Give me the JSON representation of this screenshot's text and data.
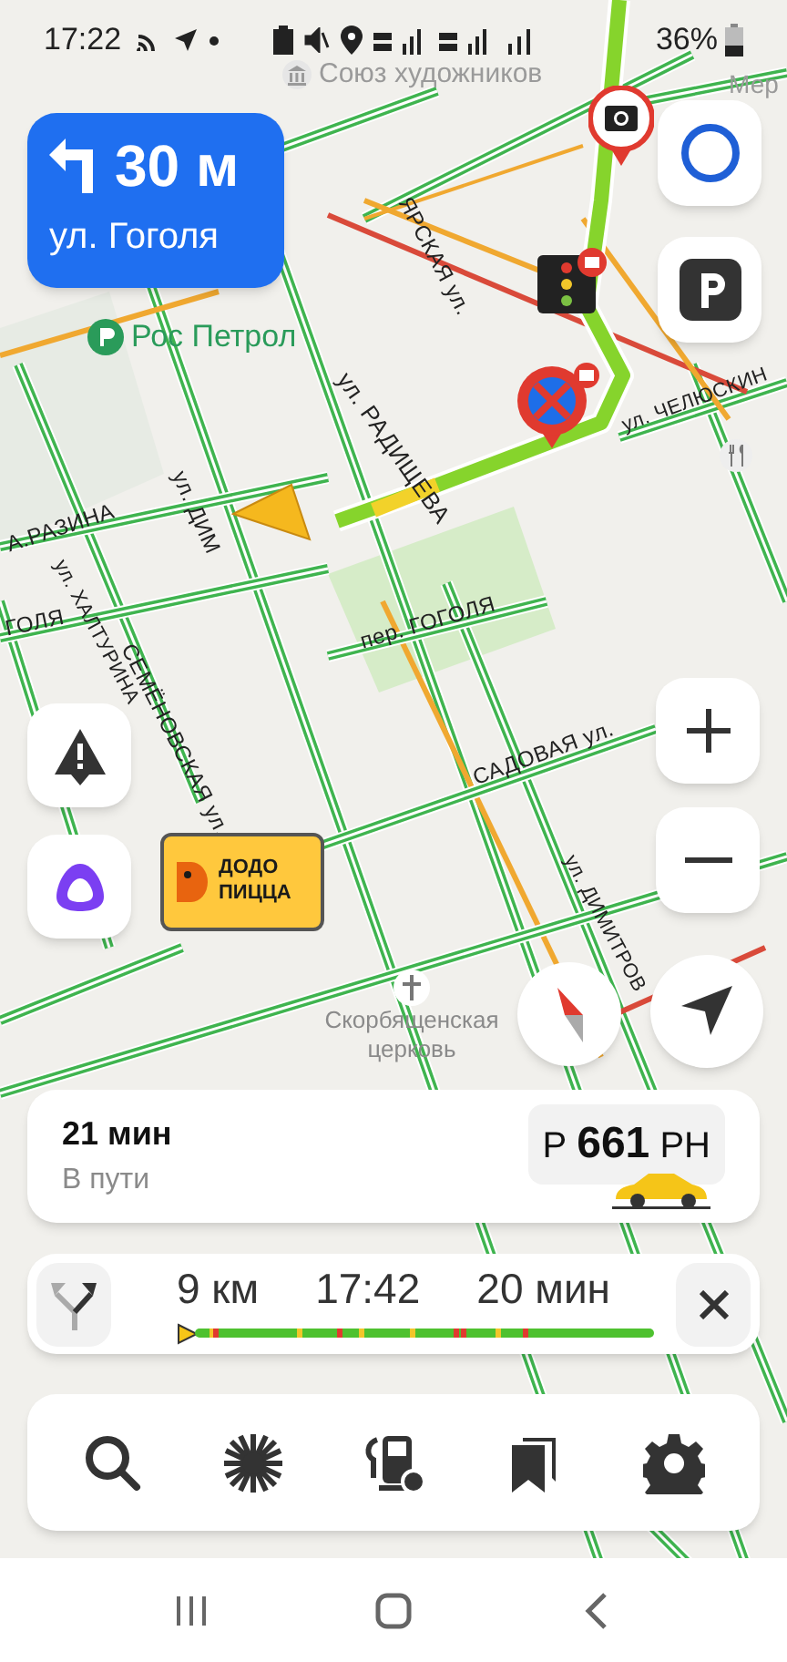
{
  "status_bar": {
    "time": "17:22",
    "battery": "36%"
  },
  "maneuver": {
    "distance": "30 м",
    "street": "ул. Гоголя"
  },
  "map_labels": [
    {
      "text": "Союз художников",
      "kind": "landmark"
    },
    {
      "text": "Мер",
      "kind": "district"
    },
    {
      "text": "ЯРСКАЯ ул.",
      "kind": "street"
    },
    {
      "text": "Рос Петрол",
      "kind": "fuel"
    },
    {
      "text": "ул. РАДИЩЕВА",
      "kind": "street"
    },
    {
      "text": "ул. ЧЕЛЮСКИН",
      "kind": "street"
    },
    {
      "text": "ул. ДИМ",
      "kind": "street"
    },
    {
      "text": "А.РАЗИНА",
      "kind": "street"
    },
    {
      "text": "ГОЛЯ",
      "kind": "street"
    },
    {
      "text": "ул. ХАЛТУРИНА",
      "kind": "street"
    },
    {
      "text": "СЕМЁНОВСКАЯ ул.",
      "kind": "street"
    },
    {
      "text": "пер. ГОГОЛЯ",
      "kind": "street"
    },
    {
      "text": "САДОВАЯ ул.",
      "kind": "street"
    },
    {
      "text": "ул. ДИМИТРОВ",
      "kind": "street"
    },
    {
      "text": "Скорбященская церковь",
      "kind": "church"
    }
  ],
  "billboard": {
    "text": "ДОДО ПИЦЦА"
  },
  "route_card": {
    "duration": "21 мин",
    "subtitle": "В пути",
    "taxi_price": "Р **661** РН"
  },
  "route_bar": {
    "distance": "9 км",
    "arrival": "17:42",
    "remaining": "20 мин"
  }
}
